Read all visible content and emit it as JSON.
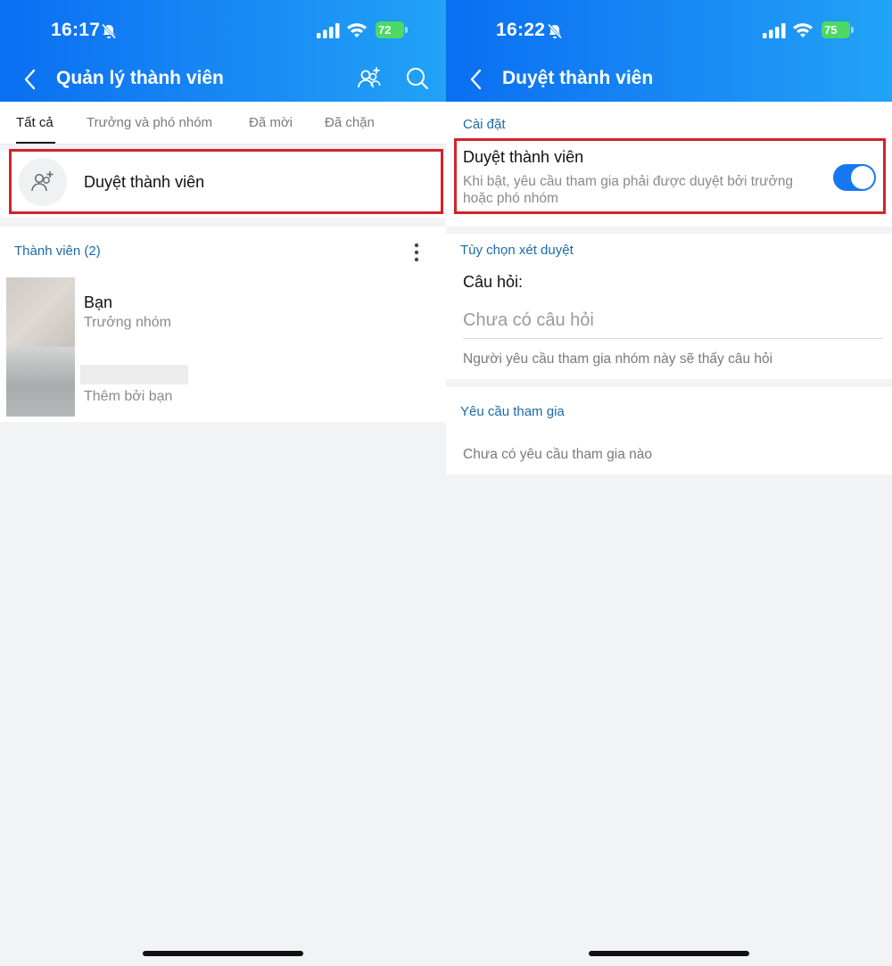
{
  "left_screen": {
    "status": {
      "time": "16:17",
      "battery": "72"
    },
    "header": {
      "title": "Quản lý thành viên"
    },
    "tabs": [
      {
        "label": "Tất cả"
      },
      {
        "label": "Trưởng và phó nhóm"
      },
      {
        "label": "Đã mời"
      },
      {
        "label": "Đã chặn"
      }
    ],
    "approve_row": {
      "label": "Duyệt thành viên"
    },
    "members_section": {
      "title": "Thành viên (2)",
      "members": [
        {
          "name": "Bạn",
          "role": "Trưởng nhóm"
        },
        {
          "name": "",
          "role": "Thêm bởi bạn"
        }
      ]
    }
  },
  "right_screen": {
    "status": {
      "time": "16:22",
      "battery": "75"
    },
    "header": {
      "title": "Duyệt thành viên"
    },
    "settings_section": {
      "title": "Cài đặt",
      "option_title": "Duyệt thành viên",
      "option_desc": "Khi bật, yêu cầu tham gia phải được duyệt bởi trưởng hoặc phó nhóm",
      "toggle_on": true
    },
    "review_section": {
      "title": "Tùy chọn xét duyệt",
      "question_label": "Câu hỏi:",
      "question_placeholder": "Chưa có câu hỏi",
      "question_value": "",
      "hint": "Người yêu cầu tham gia nhóm này sẽ thấy câu hỏi"
    },
    "requests_section": {
      "title": "Yêu cầu tham gia",
      "empty_text": "Chưa có yêu cầu tham gia nào"
    }
  },
  "colors": {
    "accent": "#0a6ff2",
    "section_title": "#1b6aa8",
    "highlight_frame": "#d3222a",
    "toggle_on": "#1677f2",
    "battery": "#4cd964"
  },
  "icons": [
    "bell-muted-icon",
    "signal-icon",
    "wifi-icon",
    "battery-icon",
    "back-icon",
    "add-member-icon",
    "search-icon",
    "more-vertical-icon"
  ]
}
